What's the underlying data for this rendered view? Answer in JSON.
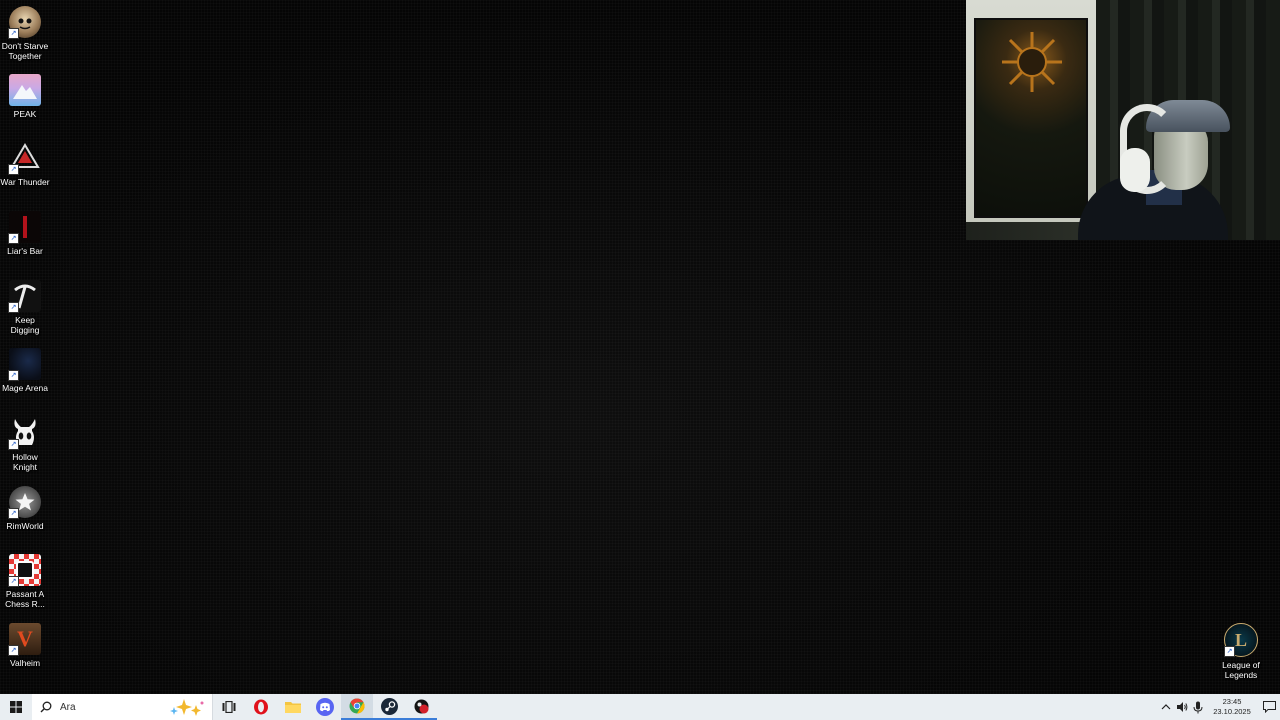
{
  "desktop_icons": [
    {
      "label": "Don't Starve Together",
      "icon": "dont-starve-icon"
    },
    {
      "label": "PEAK",
      "icon": "peak-icon"
    },
    {
      "label": "War Thunder",
      "icon": "war-thunder-icon"
    },
    {
      "label": "Liar's Bar",
      "icon": "liars-bar-icon"
    },
    {
      "label": "Keep Digging",
      "icon": "pickaxe-icon"
    },
    {
      "label": "Mage Arena",
      "icon": "mage-arena-icon"
    },
    {
      "label": "Hollow Knight",
      "icon": "hollow-knight-icon"
    },
    {
      "label": "RimWorld",
      "icon": "rimworld-icon"
    },
    {
      "label": "Passant A Chess R...",
      "icon": "passant-chess-icon"
    },
    {
      "label": "Valheim",
      "icon": "valheim-icon"
    },
    {
      "label": "League of Legends",
      "icon": "league-of-legends-icon"
    }
  ],
  "taskbar": {
    "search_placeholder": "Ara",
    "apps": [
      "opera",
      "file-explorer",
      "discord",
      "chrome",
      "steam",
      "game-app"
    ]
  },
  "tray": {
    "time": "23:45",
    "date": "23.10.2025"
  },
  "colors": {
    "taskbar_bg": "#e9eef2",
    "desktop_bg": "#060606"
  }
}
